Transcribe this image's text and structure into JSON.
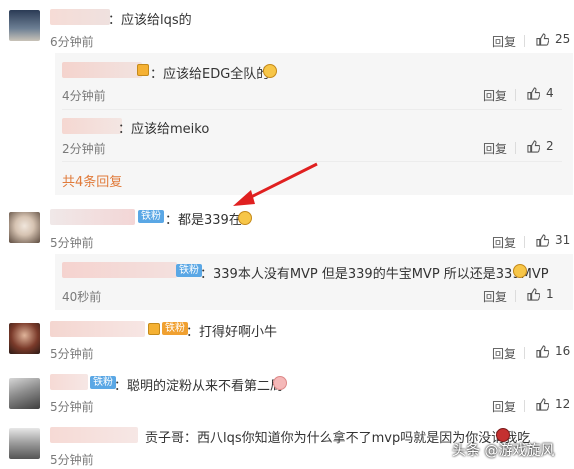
{
  "comments": [
    {
      "text": "：应该给lqs的",
      "time": "6分钟前",
      "reply": "回复",
      "likes": "25"
    },
    {
      "text": "：都是339在c",
      "badge": "铁粉",
      "time": "5分钟前",
      "reply": "回复",
      "likes": "31"
    },
    {
      "text": "：打得好啊小牛",
      "badge": "铁粉",
      "time": "5分钟前",
      "reply": "回复",
      "likes": "16"
    },
    {
      "text": "：聪明的淀粉从来不看第二局",
      "badge": "铁粉",
      "time": "5分钟前",
      "reply": "回复",
      "likes": "12"
    },
    {
      "text": "贡子哥：西八lqs你知道你为什么拿不了mvp吗就是因为你没请我吃",
      "time": "5分钟前"
    }
  ],
  "replies": [
    {
      "text": "：应该给EDG全队的",
      "time": "4分钟前",
      "reply": "回复",
      "likes": "4"
    },
    {
      "text": "：应该给meiko",
      "time": "2分钟前",
      "reply": "回复",
      "likes": "2"
    },
    {
      "text": "：339本人没有MVP 但是339的牛宝MVP 所以还是339MVP",
      "badge": "铁粉",
      "time": "40秒前",
      "reply": "回复",
      "likes": "1"
    }
  ],
  "more_replies": "共4条回复",
  "watermark": "头条 @游戏旋风",
  "colors": {
    "badge": "#5aa7e5",
    "more": "#e07b3b",
    "arrow": "#e02020"
  }
}
